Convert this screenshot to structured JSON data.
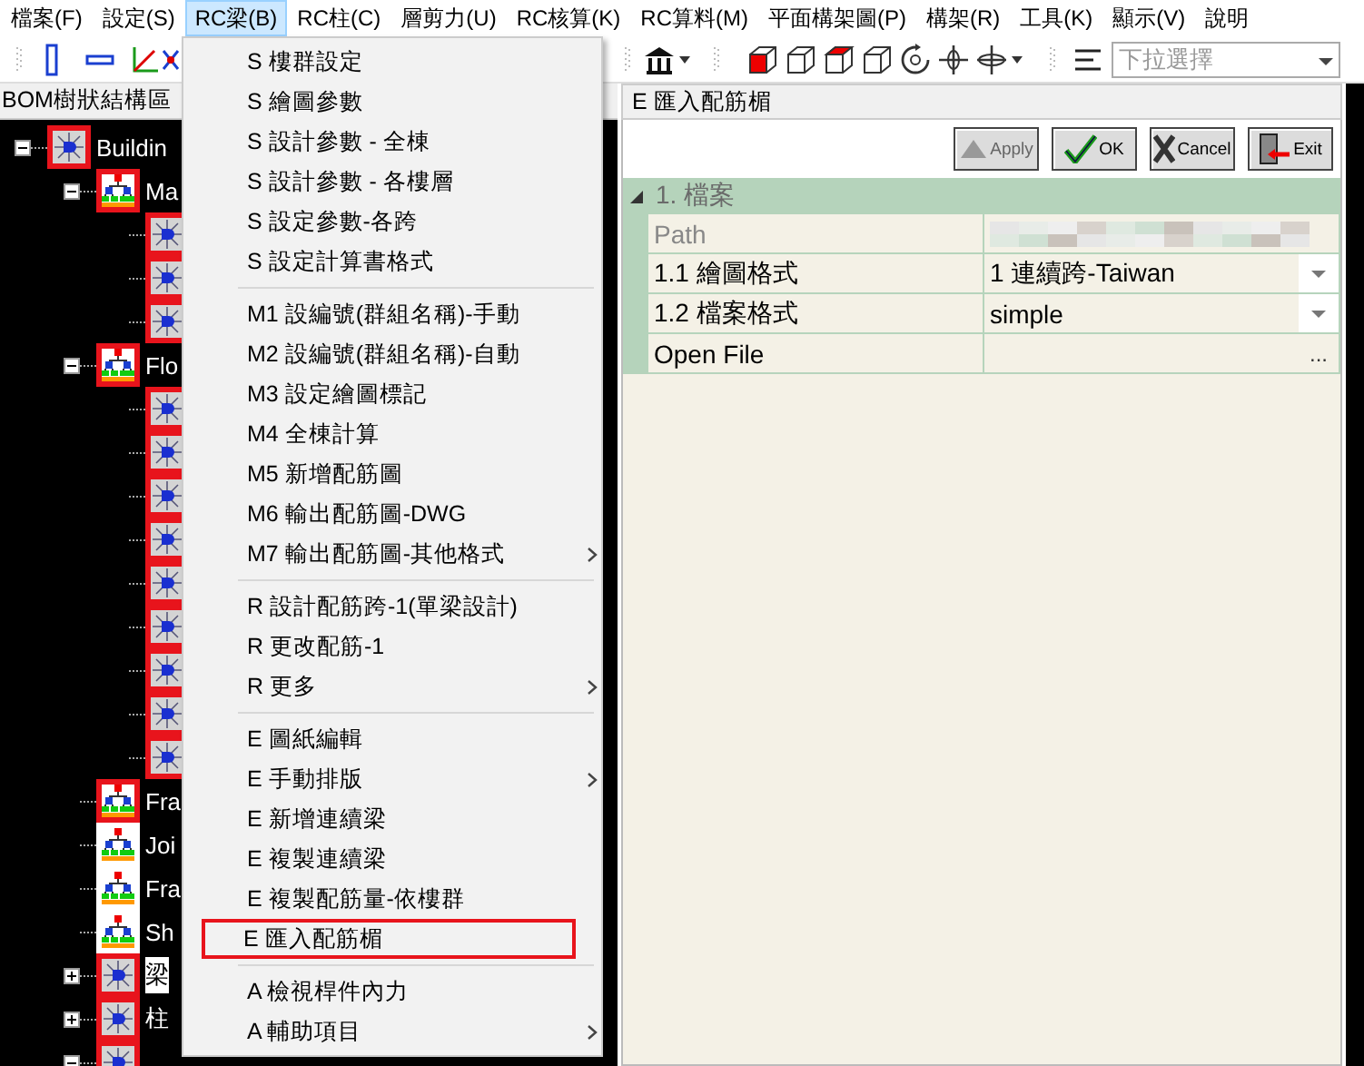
{
  "menubar": [
    {
      "label": "檔案(F)",
      "selected": false
    },
    {
      "label": "設定(S)",
      "selected": false
    },
    {
      "label": "RC梁(B)",
      "selected": true
    },
    {
      "label": "RC柱(C)",
      "selected": false
    },
    {
      "label": "層剪力(U)",
      "selected": false
    },
    {
      "label": "RC核算(K)",
      "selected": false
    },
    {
      "label": "RC算料(M)",
      "selected": false
    },
    {
      "label": "平面構架圖(P)",
      "selected": false
    },
    {
      "label": "構架(R)",
      "selected": false
    },
    {
      "label": "工具(K)",
      "selected": false
    },
    {
      "label": "顯示(V)",
      "selected": false
    },
    {
      "label": "說明",
      "selected": false
    }
  ],
  "toolbar": {
    "combo": {
      "placeholder": "下拉選擇"
    }
  },
  "tree": {
    "title": "BOM樹狀結構區",
    "items": [
      {
        "label": "Buildin",
        "kind": "beam",
        "flagged": true,
        "selected": false,
        "expanded": true,
        "children": [
          {
            "label": "Ma",
            "kind": "group",
            "flagged": true,
            "selected": false,
            "expanded": true,
            "children": [
              {
                "kind": "beam",
                "flagged": true,
                "selected": false
              },
              {
                "kind": "beam",
                "flagged": true,
                "selected": false
              },
              {
                "kind": "beam",
                "flagged": true,
                "selected": false
              }
            ]
          },
          {
            "label": "Flo",
            "kind": "group",
            "flagged": true,
            "selected": false,
            "expanded": true,
            "children": [
              {
                "kind": "beam",
                "flagged": true,
                "selected": false
              },
              {
                "kind": "beam",
                "flagged": true,
                "selected": false
              },
              {
                "kind": "beam",
                "flagged": true,
                "selected": false
              },
              {
                "kind": "beam",
                "flagged": true,
                "selected": false
              },
              {
                "kind": "beam",
                "flagged": true,
                "selected": false
              },
              {
                "kind": "beam",
                "flagged": true,
                "selected": false
              },
              {
                "kind": "beam",
                "flagged": true,
                "selected": false
              },
              {
                "kind": "beam",
                "flagged": true,
                "selected": false
              },
              {
                "kind": "beam",
                "flagged": true,
                "selected": false
              }
            ]
          },
          {
            "label": "Fra",
            "kind": "group",
            "flagged": true,
            "selected": false
          },
          {
            "label": "Joi",
            "kind": "group",
            "flagged": false,
            "selected": false
          },
          {
            "label": "Fra",
            "kind": "group",
            "flagged": false,
            "selected": false
          },
          {
            "label": "Sh",
            "kind": "group",
            "flagged": false,
            "selected": false
          },
          {
            "label": "梁",
            "kind": "beam",
            "flagged": true,
            "selected": true,
            "expanded": false
          },
          {
            "label": "柱",
            "kind": "beam",
            "flagged": true,
            "selected": false,
            "expanded": false
          },
          {
            "kind": "beam",
            "flagged": true,
            "selected": false,
            "expanded": true
          }
        ]
      }
    ]
  },
  "menu": {
    "items": [
      {
        "kind": "item",
        "label": "S 樓群設定",
        "submenu": false,
        "selected": false
      },
      {
        "kind": "item",
        "label": "S 繪圖參數",
        "submenu": false,
        "selected": false
      },
      {
        "kind": "item",
        "label": "S 設計參數 - 全棟",
        "submenu": false,
        "selected": false
      },
      {
        "kind": "item",
        "label": "S 設計參數 - 各樓層",
        "submenu": false,
        "selected": false
      },
      {
        "kind": "item",
        "label": "S 設定參數-各跨",
        "submenu": false,
        "selected": false
      },
      {
        "kind": "item",
        "label": "S 設定計算書格式",
        "submenu": false,
        "selected": false
      },
      {
        "kind": "separator"
      },
      {
        "kind": "item",
        "label": "M1 設編號(群組名稱)-手動",
        "submenu": false,
        "selected": false
      },
      {
        "kind": "item",
        "label": "M2 設編號(群組名稱)-自動",
        "submenu": false,
        "selected": false
      },
      {
        "kind": "item",
        "label": "M3 設定繪圖標記",
        "submenu": false,
        "selected": false
      },
      {
        "kind": "item",
        "label": "M4 全棟計算",
        "submenu": false,
        "selected": false
      },
      {
        "kind": "item",
        "label": "M5 新增配筋圖",
        "submenu": false,
        "selected": false
      },
      {
        "kind": "item",
        "label": "M6 輸出配筋圖-DWG",
        "submenu": false,
        "selected": false
      },
      {
        "kind": "item",
        "label": "M7 輸出配筋圖-其他格式",
        "submenu": true,
        "selected": false
      },
      {
        "kind": "separator"
      },
      {
        "kind": "item",
        "label": "R 設計配筋跨-1(單梁設計)",
        "submenu": false,
        "selected": false
      },
      {
        "kind": "item",
        "label": "R 更改配筋-1",
        "submenu": false,
        "selected": false
      },
      {
        "kind": "item",
        "label": "R 更多",
        "submenu": true,
        "selected": false
      },
      {
        "kind": "separator"
      },
      {
        "kind": "item",
        "label": "E 圖紙編輯",
        "submenu": false,
        "selected": false
      },
      {
        "kind": "item",
        "label": "E 手動排版",
        "submenu": true,
        "selected": false
      },
      {
        "kind": "item",
        "label": "E 新增連續梁",
        "submenu": false,
        "selected": false
      },
      {
        "kind": "item",
        "label": "E 複製連續梁",
        "submenu": false,
        "selected": false
      },
      {
        "kind": "item",
        "label": "E 複製配筋量-依樓群",
        "submenu": false,
        "selected": false
      },
      {
        "kind": "item",
        "label": "E 匯入配筋楣",
        "submenu": false,
        "selected": true
      },
      {
        "kind": "separator"
      },
      {
        "kind": "item",
        "label": "A 檢視桿件內力",
        "submenu": false,
        "selected": false
      },
      {
        "kind": "item",
        "label": "A 輔助項目",
        "submenu": true,
        "selected": false
      }
    ]
  },
  "properties": {
    "title": "E 匯入配筋楣",
    "buttons": [
      {
        "kind": "apply",
        "label": "Apply",
        "disabled": true
      },
      {
        "kind": "ok",
        "label": "OK",
        "disabled": false
      },
      {
        "kind": "cancel",
        "label": "Cancel",
        "disabled": false
      },
      {
        "kind": "exit",
        "label": "Exit",
        "disabled": false
      }
    ],
    "groups": [
      {
        "label": "1. 檔案",
        "expanded": true,
        "rows": [
          {
            "kind": "blurred",
            "name": "Path",
            "disabled": true
          },
          {
            "kind": "dropdown",
            "name": "1.1 繪圖格式",
            "value": "1 連續跨-Taiwan",
            "disabled": false
          },
          {
            "kind": "dropdown",
            "name": "1.2 檔案格式",
            "value": "simple",
            "disabled": false
          },
          {
            "kind": "browse",
            "name": "Open File",
            "button": "...",
            "disabled": false
          }
        ]
      }
    ]
  }
}
